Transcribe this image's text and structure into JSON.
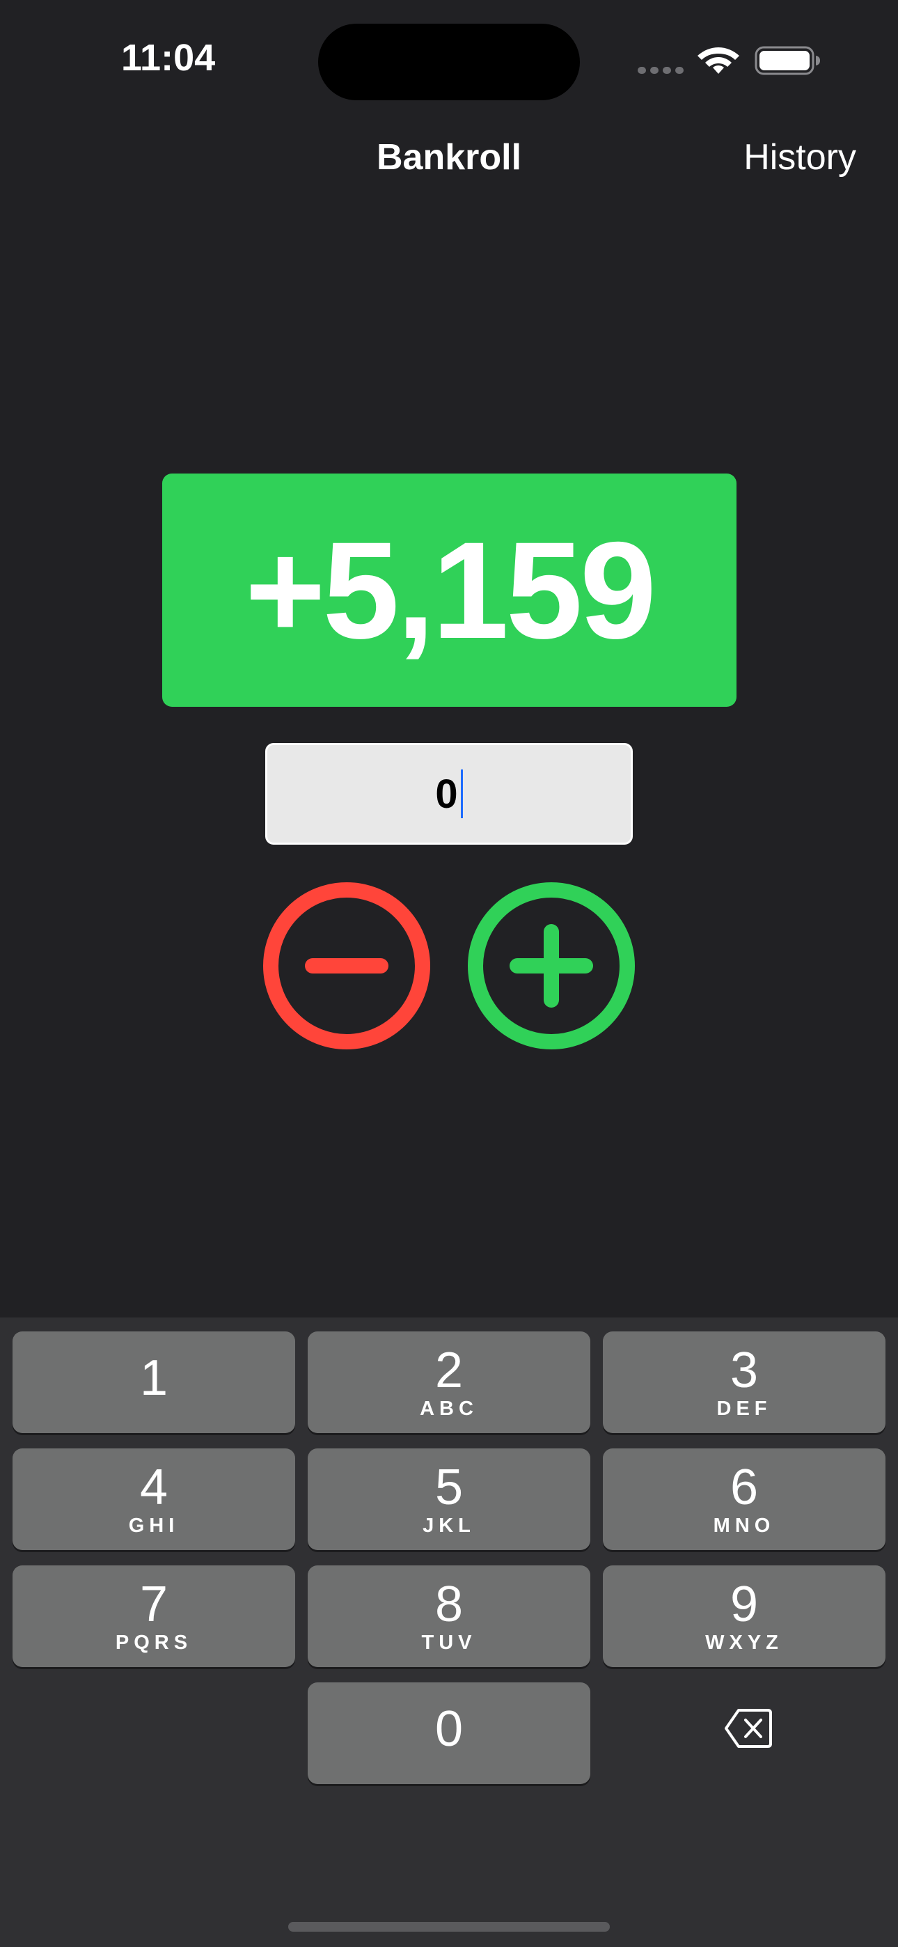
{
  "status_bar": {
    "time": "11:04",
    "wifi_icon": "wifi-icon",
    "battery_icon": "battery-icon",
    "signal_icon": "cellular-signal-icon"
  },
  "nav": {
    "title": "Bankroll",
    "history_label": "History"
  },
  "bankroll": {
    "value": "+5,159",
    "color": "#30d158"
  },
  "amount_input": {
    "value": "0"
  },
  "buttons": {
    "subtract_icon": "minus-circle-icon",
    "subtract_color": "#ff453a",
    "add_icon": "plus-circle-icon",
    "add_color": "#30d158"
  },
  "keypad": {
    "keys": [
      {
        "num": "1",
        "letters": ""
      },
      {
        "num": "2",
        "letters": "ABC"
      },
      {
        "num": "3",
        "letters": "DEF"
      },
      {
        "num": "4",
        "letters": "GHI"
      },
      {
        "num": "5",
        "letters": "JKL"
      },
      {
        "num": "6",
        "letters": "MNO"
      },
      {
        "num": "7",
        "letters": "PQRS"
      },
      {
        "num": "8",
        "letters": "TUV"
      },
      {
        "num": "9",
        "letters": "WXYZ"
      },
      {
        "num": "0",
        "letters": ""
      }
    ],
    "backspace_icon": "backspace-icon"
  }
}
